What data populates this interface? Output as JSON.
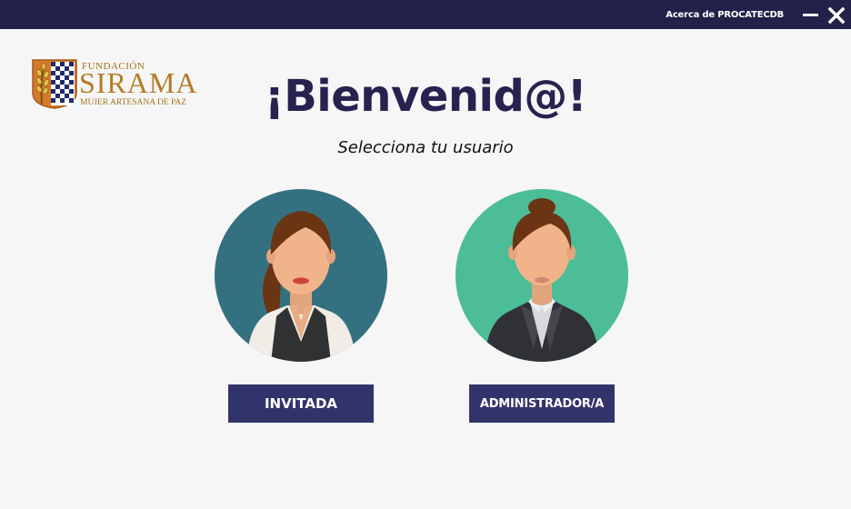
{
  "window": {
    "about_label": "Acerca de PROCATECDB",
    "minimize_icon": "minimize-icon",
    "close_icon": "close-icon"
  },
  "logo": {
    "line1": "FUNDACIÓN",
    "line2": "SIRAMA",
    "line3": "MUJER ARTESANA DE PAZ",
    "colors": {
      "gold": "#b47b23",
      "navy": "#1f2b6b",
      "orange": "#e07a2c"
    }
  },
  "main": {
    "title": "¡Bienvenid@!",
    "subtitle": "Selecciona tu usuario"
  },
  "users": {
    "guest": {
      "label": "INVITADA",
      "avatar_bg": "#347180"
    },
    "admin": {
      "label": "ADMINISTRADOR/A",
      "avatar_bg": "#4cbd96"
    }
  },
  "colors": {
    "titlebar": "#23204a",
    "button": "#33336b",
    "title_text": "#27234f",
    "background": "#f6f6f6"
  }
}
